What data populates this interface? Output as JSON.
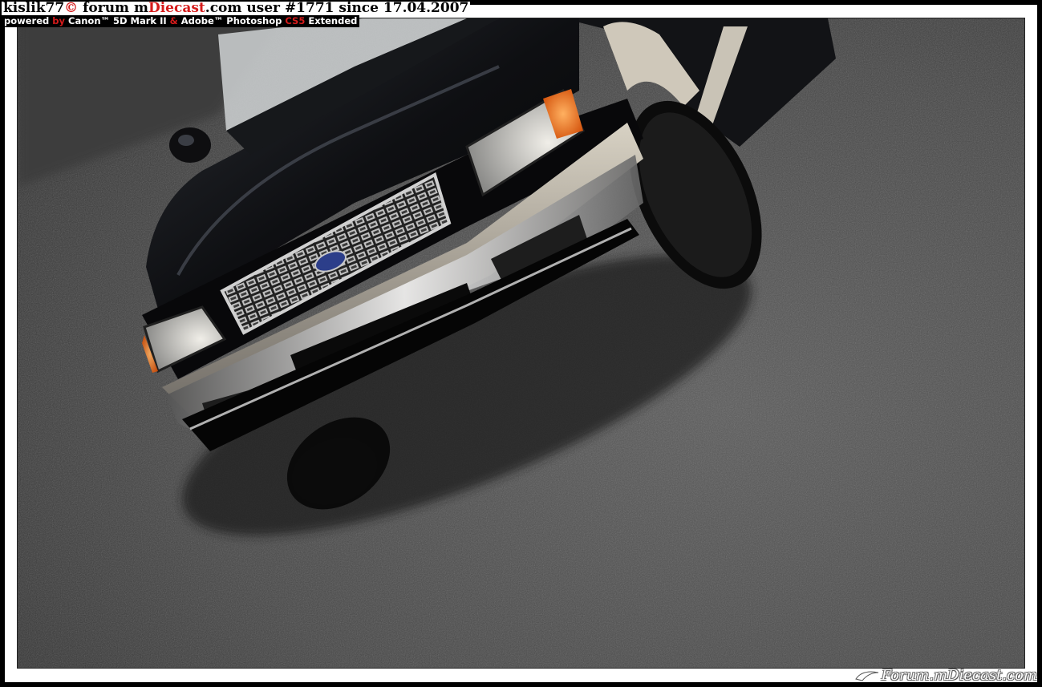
{
  "watermark": {
    "user": "kislik77",
    "copyright": "©",
    "forum_prefix": "forum m",
    "forum_brand": "Diecast",
    "forum_suffix": ".com",
    "user_label": "user",
    "user_id": "#1771",
    "since_label": "since",
    "since_date": "17.04.2007",
    "powered": "powered",
    "by": "by",
    "camera": "Canon™ 5D Mark II",
    "amp": "&",
    "software": "Adobe™ Photoshop",
    "cs5": "CS5",
    "extended": "Extended"
  },
  "logo": {
    "prefix": "orum.mDiecast.com",
    "initial": "F"
  },
  "photo": {
    "subject": "black diecast pickup truck on asphalt",
    "colors": {
      "body": "#0d0d10",
      "bumper": "#b8b2a6",
      "road": "#4a4a4a",
      "indicator": "#f07a1a",
      "badge": "#2c3e8a"
    }
  }
}
